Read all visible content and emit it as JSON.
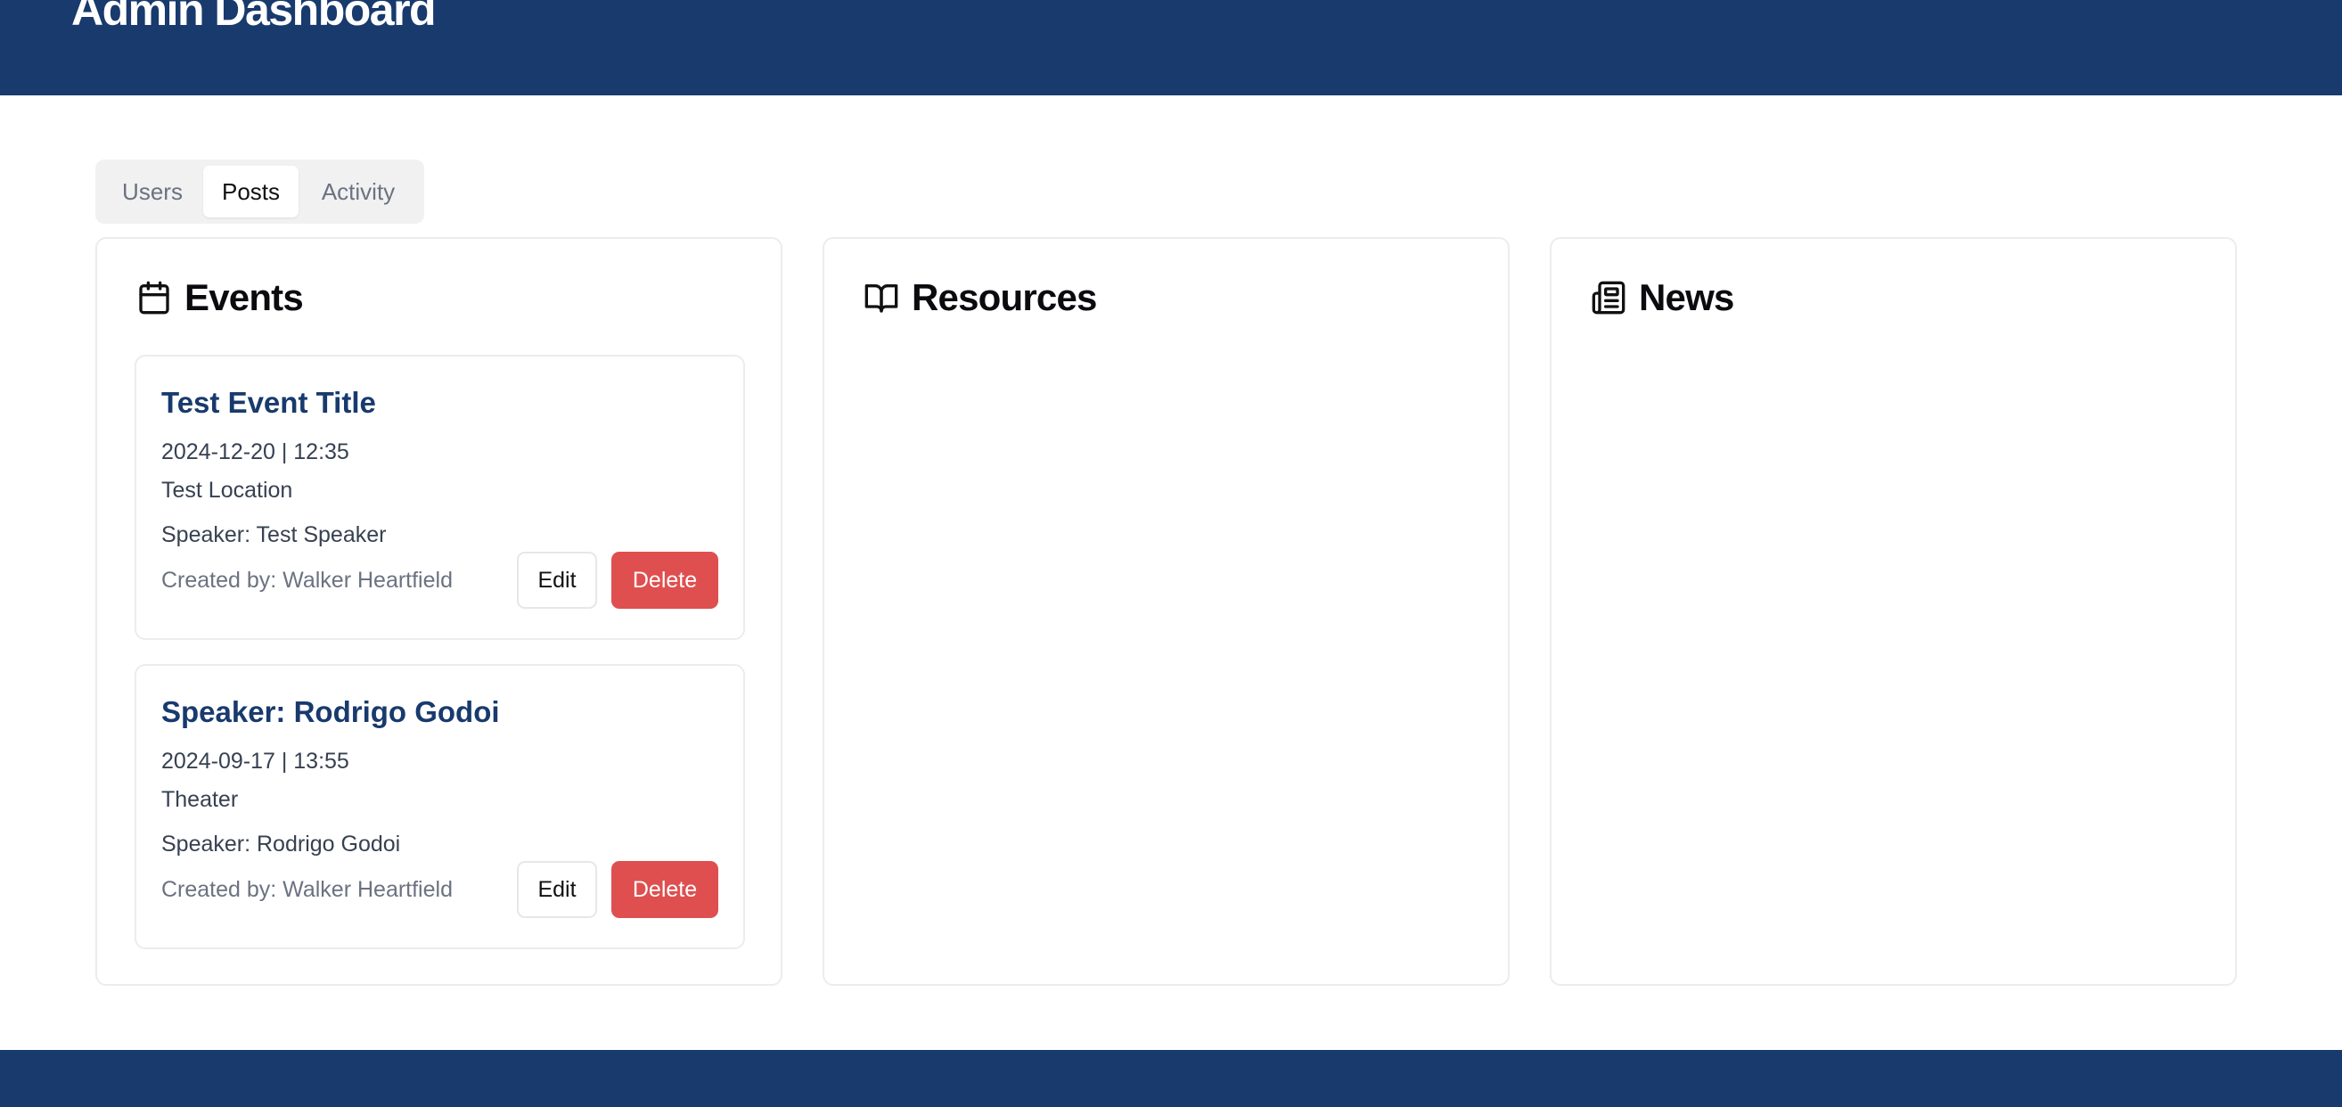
{
  "header": {
    "title": "Admin Dashboard"
  },
  "tabs": [
    {
      "label": "Users",
      "active": false
    },
    {
      "label": "Posts",
      "active": true
    },
    {
      "label": "Activity",
      "active": false
    }
  ],
  "panels": {
    "events": {
      "title": "Events",
      "icon": "calendar-icon",
      "items": [
        {
          "title": "Test Event Title",
          "datetime": "2024-12-20 | 12:35",
          "location": "Test Location",
          "speaker": "Speaker: Test Speaker",
          "created_by": "Created by: Walker Heartfield",
          "edit_label": "Edit",
          "delete_label": "Delete"
        },
        {
          "title": "Speaker: Rodrigo Godoi",
          "datetime": "2024-09-17 | 13:55",
          "location": "Theater",
          "speaker": "Speaker: Rodrigo Godoi",
          "created_by": "Created by: Walker Heartfield",
          "edit_label": "Edit",
          "delete_label": "Delete"
        }
      ]
    },
    "resources": {
      "title": "Resources",
      "icon": "book-open-icon"
    },
    "news": {
      "title": "News",
      "icon": "newspaper-icon"
    }
  },
  "colors": {
    "header_bg": "#183a6d",
    "event_title": "#183a6d",
    "delete_button": "#df4f4f"
  }
}
